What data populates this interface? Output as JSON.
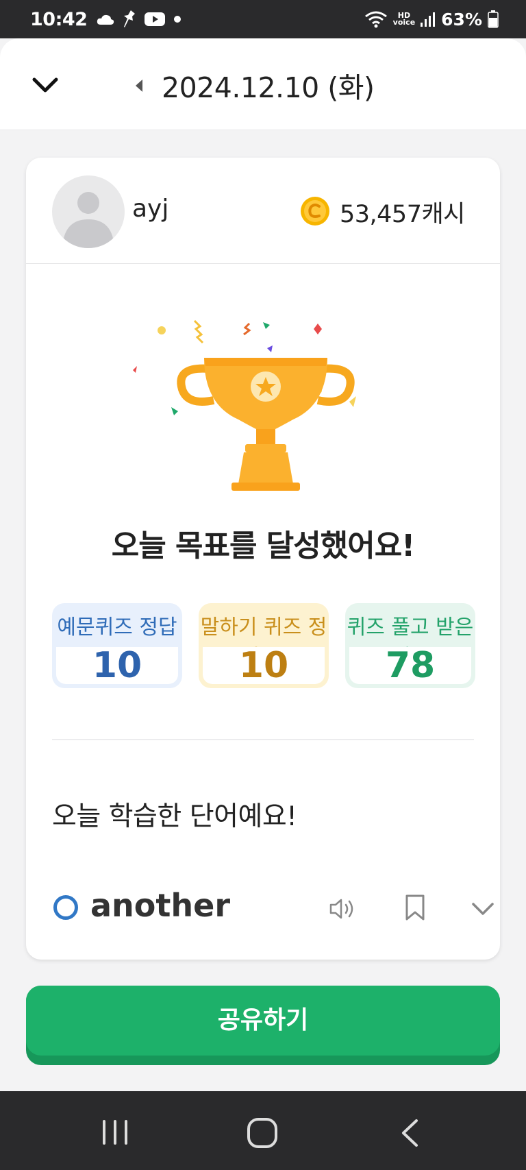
{
  "status_bar": {
    "time": "10:42",
    "battery": "63%",
    "hd_label_top": "HD",
    "hd_label_bottom": "voice",
    "icons": [
      "cloud-icon",
      "pin-icon",
      "youtube-icon",
      "dot-icon",
      "wifi-icon",
      "signal-icon",
      "battery-icon"
    ]
  },
  "header": {
    "date": "2024.12.10 (화)"
  },
  "user": {
    "name": "ayj",
    "cash": "53,457캐시"
  },
  "achievement": {
    "title": "오늘 목표를 달성했어요!"
  },
  "stats": [
    {
      "label": "예문퀴즈 정답 수",
      "value": "10"
    },
    {
      "label": "말하기 퀴즈 정답 수",
      "value": "10"
    },
    {
      "label": "퀴즈 풀고 받은 캐시",
      "value": "78"
    }
  ],
  "words": {
    "title": "오늘 학습한 단어예요!",
    "items": [
      {
        "word": "another"
      }
    ]
  },
  "share": {
    "label": "공유하기"
  },
  "colors": {
    "accent_green": "#1db16a",
    "blue": "#2e63ad",
    "gold": "#bd7f12",
    "green": "#1e9c62",
    "trophy": "#fbb12e"
  }
}
